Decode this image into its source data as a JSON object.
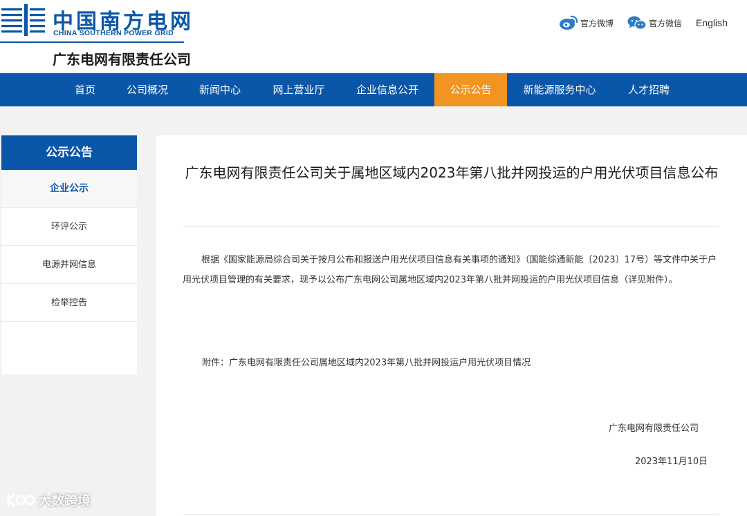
{
  "header": {
    "logo_cn": "中国南方电网",
    "logo_en": "CHINA SOUTHERN POWER GRID",
    "company": "广东电网有限责任公司",
    "links": {
      "weibo": "官方微博",
      "wechat": "官方微信",
      "english": "English"
    }
  },
  "nav": {
    "items": [
      "首页",
      "公司概况",
      "新闻中心",
      "网上营业厅",
      "企业信息公开",
      "公示公告",
      "新能源服务中心",
      "人才招聘"
    ],
    "active": "公示公告"
  },
  "sidebar": {
    "title": "公示公告",
    "items": [
      "企业公示",
      "环评公示",
      "电源并网信息",
      "检举控告"
    ],
    "active": "企业公示"
  },
  "article": {
    "title": "广东电网有限责任公司关于属地区域内2023年第八批并网投运的户用光伏项目信息公布",
    "paragraph": "根据《国家能源局综合司关于按月公布和报送户用光伏项目信息有关事项的通知》（国能综通新能〔2023〕17号）等文件中关于户用光伏项目管理的有关要求，现予以公布广东电网公司属地区域内2023年第八批并网投运的户用光伏项目信息（详见附件）。",
    "attachment": "附件：广东电网有限责任公司属地区域内2023年第八批并网投运户用光伏项目情况",
    "signer": "广东电网有限责任公司",
    "date": "2023年11月10日"
  },
  "watermark": "大数跨境",
  "colors": {
    "brand_blue": "#0a56a8",
    "active_orange": "#f29421",
    "background": "#f2f2f2"
  },
  "icons": [
    "grid-logo-icon",
    "weibo-icon",
    "wechat-icon",
    "watermark-logo-icon"
  ]
}
